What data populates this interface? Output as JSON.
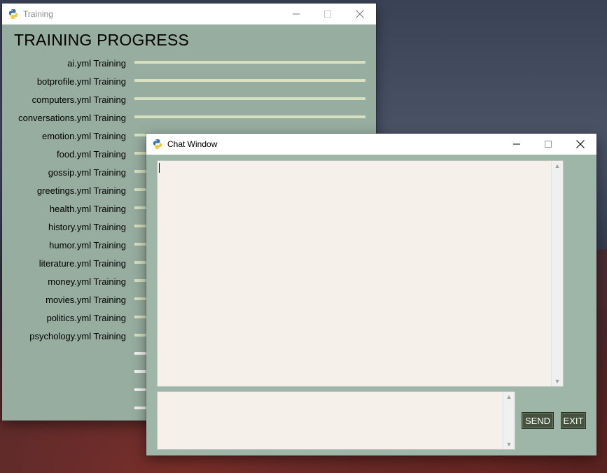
{
  "training_window": {
    "title": "Training",
    "heading": "TRAINING PROGRESS",
    "rows": [
      {
        "label": "ai.yml Training",
        "progress": 1.0
      },
      {
        "label": "botprofile.yml Training",
        "progress": 1.0
      },
      {
        "label": "computers.yml Training",
        "progress": 1.0
      },
      {
        "label": "conversations.yml Training",
        "progress": 1.0
      },
      {
        "label": "emotion.yml Training",
        "progress": 1.0
      },
      {
        "label": "food.yml Training",
        "progress": 1.0
      },
      {
        "label": "gossip.yml Training",
        "progress": 1.0
      },
      {
        "label": "greetings.yml Training",
        "progress": 1.0
      },
      {
        "label": "health.yml Training",
        "progress": 1.0
      },
      {
        "label": "history.yml Training",
        "progress": 1.0
      },
      {
        "label": "humor.yml Training",
        "progress": 1.0
      },
      {
        "label": "literature.yml Training",
        "progress": 1.0
      },
      {
        "label": "money.yml Training",
        "progress": 1.0
      },
      {
        "label": "movies.yml Training",
        "progress": 1.0
      },
      {
        "label": "politics.yml Training",
        "progress": 1.0
      },
      {
        "label": "psychology.yml Training",
        "progress": 1.0
      }
    ],
    "extra_bars": 4
  },
  "chat_window": {
    "title": "Chat Window",
    "chat_log": "",
    "message_input": "",
    "send_label": "SEND",
    "exit_label": "EXIT"
  },
  "colors": {
    "training_bg": "#96ad9f",
    "chat_bg": "#9db6a8",
    "bar_fill": "#d7e0bf",
    "button_bg": "#45523d",
    "textbox_bg": "#f5f0ea"
  },
  "icons": {
    "app": "python-icon",
    "minimize": "minimize-icon",
    "maximize": "maximize-icon",
    "close": "close-icon"
  }
}
